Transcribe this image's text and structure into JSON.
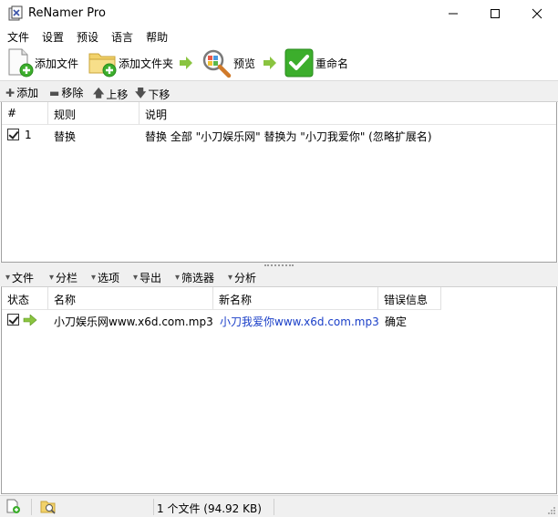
{
  "window": {
    "title": "ReNamer Pro",
    "minimize_glyph": "—",
    "maximize_glyph": "☐",
    "close_glyph": "✕"
  },
  "menu": [
    "文件",
    "设置",
    "预设",
    "语言",
    "帮助"
  ],
  "toolbar": {
    "add_files": "添加文件",
    "add_folder": "添加文件夹",
    "preview": "预览",
    "rename": "重命名"
  },
  "rules_toolbar": {
    "add": "添加",
    "remove": "移除",
    "up": "上移",
    "down": "下移"
  },
  "rules_table": {
    "columns": [
      "#",
      "规则",
      "说明"
    ],
    "rows": [
      {
        "checked": true,
        "index": "1",
        "rule": "替换",
        "description": "替换 全部 \"小刀娱乐网\" 替换为 \"小刀我爱你\" (忽略扩展名)"
      }
    ]
  },
  "files_toolbar": {
    "files": "文件",
    "columns": "分栏",
    "options": "选项",
    "export": "导出",
    "filters": "筛选器",
    "analyze": "分析"
  },
  "files_table": {
    "columns": [
      "状态",
      "名称",
      "新名称",
      "错误信息"
    ],
    "rows": [
      {
        "checked": true,
        "name": "小刀娱乐网www.x6d.com.mp3",
        "new_name": "小刀我爱你www.x6d.com.mp3",
        "error": "确定"
      }
    ]
  },
  "status": {
    "summary": "1 个文件 (94.92 KB)"
  },
  "colors": {
    "accent_green": "#3cae2c",
    "new_name_blue": "#1a3fc8",
    "arrow_green": "#8ac440"
  },
  "icons": {
    "add_files": "page-add-icon",
    "add_folder": "folder-add-icon",
    "preview": "magnifier-icon",
    "rename": "green-check-icon"
  }
}
